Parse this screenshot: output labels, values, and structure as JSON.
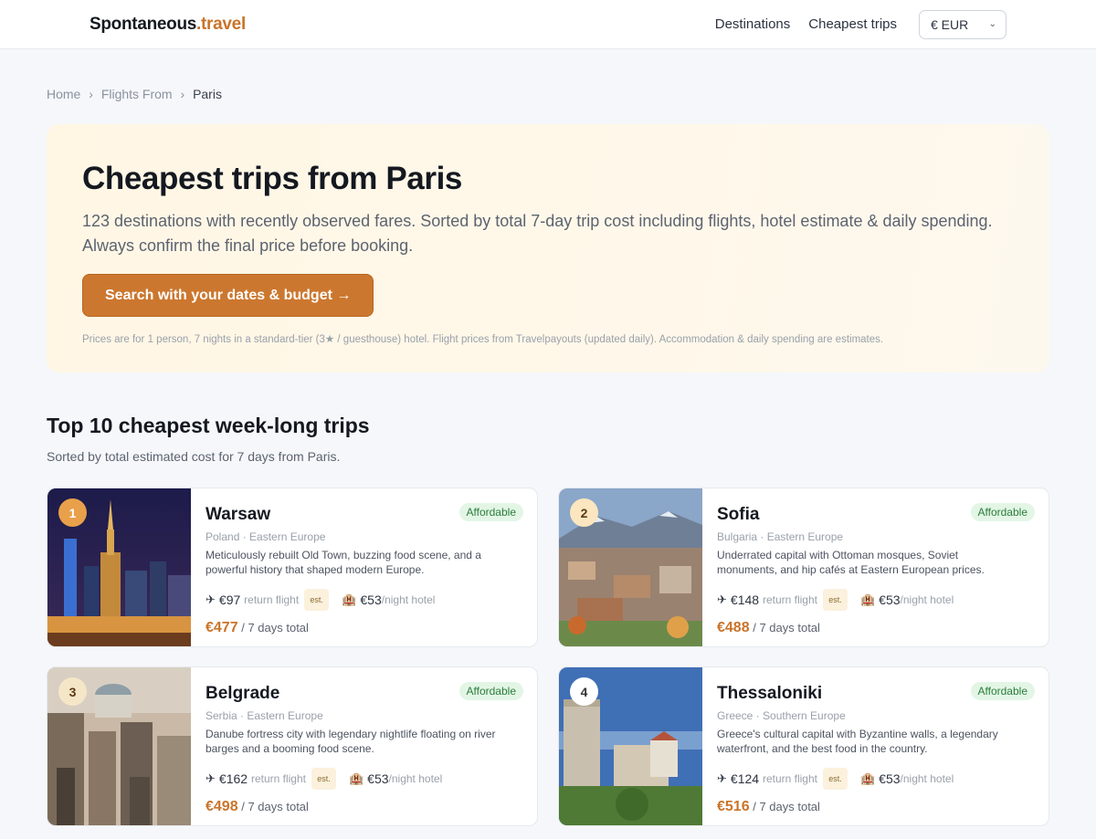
{
  "logo": {
    "main": "Spontaneous",
    "accent": ".travel"
  },
  "nav": {
    "destinations": "Destinations",
    "cheapest": "Cheapest trips",
    "currency": "€ EUR"
  },
  "breadcrumb": {
    "home": "Home",
    "flights_from": "Flights From",
    "current": "Paris",
    "sep": "›"
  },
  "hero": {
    "title": "Cheapest trips from Paris",
    "subtitle": "123 destinations with recently observed fares. Sorted by total 7-day trip cost including flights, hotel estimate & daily spending. Always confirm the final price before booking.",
    "cta": "Search with your dates & budget →",
    "note": "Prices are for 1 person, 7 nights in a standard-tier (3★ / guesthouse) hotel. Flight prices from Travelpayouts (updated daily). Accommodation & daily spending are estimates."
  },
  "section": {
    "title": "Top 10 cheapest week-long trips",
    "subtitle": "Sorted by total estimated cost for 7 days from Paris."
  },
  "labels": {
    "return_flight": "return flight",
    "est": "est.",
    "night_hotel": "/night hotel",
    "days_total": "/ 7 days total"
  },
  "cards": [
    {
      "rank": "1",
      "city": "Warsaw",
      "region": "Poland · Eastern Europe",
      "badge": "Affordable",
      "desc": "Meticulously rebuilt Old Town, buzzing food scene, and a powerful history that shaped modern Europe.",
      "flight": "€97",
      "hotel": "€53",
      "total": "€477",
      "rank_bg": "#e8a04a"
    },
    {
      "rank": "2",
      "city": "Sofia",
      "region": "Bulgaria · Eastern Europe",
      "badge": "Affordable",
      "desc": "Underrated capital with Ottoman mosques, Soviet monuments, and hip cafés at Eastern European prices.",
      "flight": "€148",
      "hotel": "€53",
      "total": "€488",
      "rank_bg": "#fbe6bf"
    },
    {
      "rank": "3",
      "city": "Belgrade",
      "region": "Serbia · Eastern Europe",
      "badge": "Affordable",
      "desc": "Danube fortress city with legendary nightlife floating on river barges and a booming food scene.",
      "flight": "€162",
      "hotel": "€53",
      "total": "€498",
      "rank_bg": "#f6e6c8"
    },
    {
      "rank": "4",
      "city": "Thessaloniki",
      "region": "Greece · Southern Europe",
      "badge": "Affordable",
      "desc": "Greece's cultural capital with Byzantine walls, a legendary waterfront, and the best food in the country.",
      "flight": "€124",
      "hotel": "€53",
      "total": "€516",
      "rank_bg": "#ffffff"
    }
  ]
}
